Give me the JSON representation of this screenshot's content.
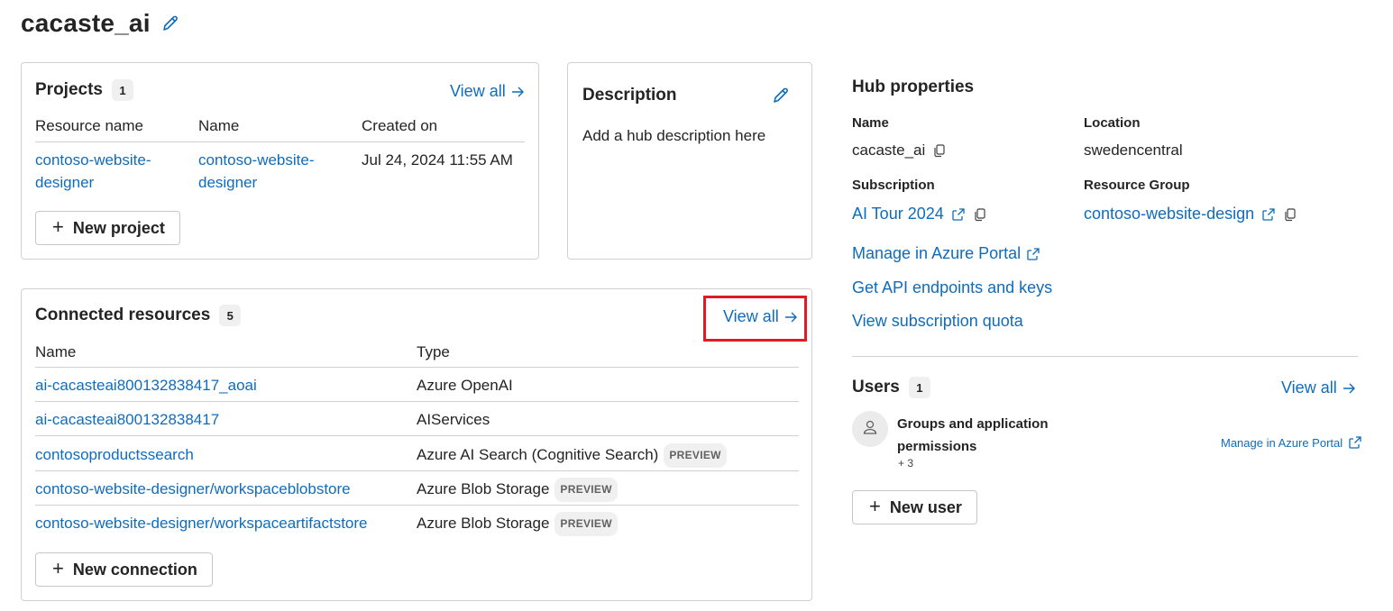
{
  "page": {
    "title": "cacaste_ai"
  },
  "projects": {
    "title": "Projects",
    "count": "1",
    "view_all": "View all",
    "columns": [
      "Resource name",
      "Name",
      "Created on"
    ],
    "rows": [
      {
        "resource_name": "contoso-website-designer",
        "name": "contoso-website-designer",
        "created_on": "Jul 24, 2024 11:55 AM"
      }
    ],
    "new_button": "New project"
  },
  "description": {
    "title": "Description",
    "placeholder": "Add a hub description here"
  },
  "connected": {
    "title": "Connected resources",
    "count": "5",
    "view_all": "View all",
    "columns": [
      "Name",
      "Type"
    ],
    "rows": [
      {
        "name": "ai-cacasteai800132838417_aoai",
        "type": "Azure OpenAI",
        "preview": ""
      },
      {
        "name": "ai-cacasteai800132838417",
        "type": "AIServices",
        "preview": ""
      },
      {
        "name": "contosoproductssearch",
        "type": "Azure AI Search (Cognitive Search)",
        "preview": "PREVIEW"
      },
      {
        "name": "contoso-website-designer/workspaceblobstore",
        "type": "Azure Blob Storage",
        "preview": "PREVIEW"
      },
      {
        "name": "contoso-website-designer/workspaceartifactstore",
        "type": "Azure Blob Storage",
        "preview": "PREVIEW"
      }
    ],
    "new_button": "New connection"
  },
  "hub": {
    "title": "Hub properties",
    "name_label": "Name",
    "name_value": "cacaste_ai",
    "location_label": "Location",
    "location_value": "swedencentral",
    "subscription_label": "Subscription",
    "subscription_value": "AI Tour 2024",
    "resource_group_label": "Resource Group",
    "resource_group_value": "contoso-website-design",
    "links": [
      "Manage in Azure Portal",
      "Get API endpoints and keys",
      "View subscription quota"
    ]
  },
  "users": {
    "title": "Users",
    "count": "1",
    "view_all": "View all",
    "group_name": "Groups and application permissions",
    "group_extra": "+ 3",
    "manage_link": "Manage in Azure Portal",
    "new_button": "New user"
  },
  "icons": [
    "pencil-icon",
    "arrow-right-icon",
    "copy-icon",
    "open-external-icon",
    "person-icon",
    "plus-icon"
  ],
  "colors": {
    "link": "#0f6cbd",
    "highlight": "#e21a23",
    "border": "#d1d1d1"
  }
}
